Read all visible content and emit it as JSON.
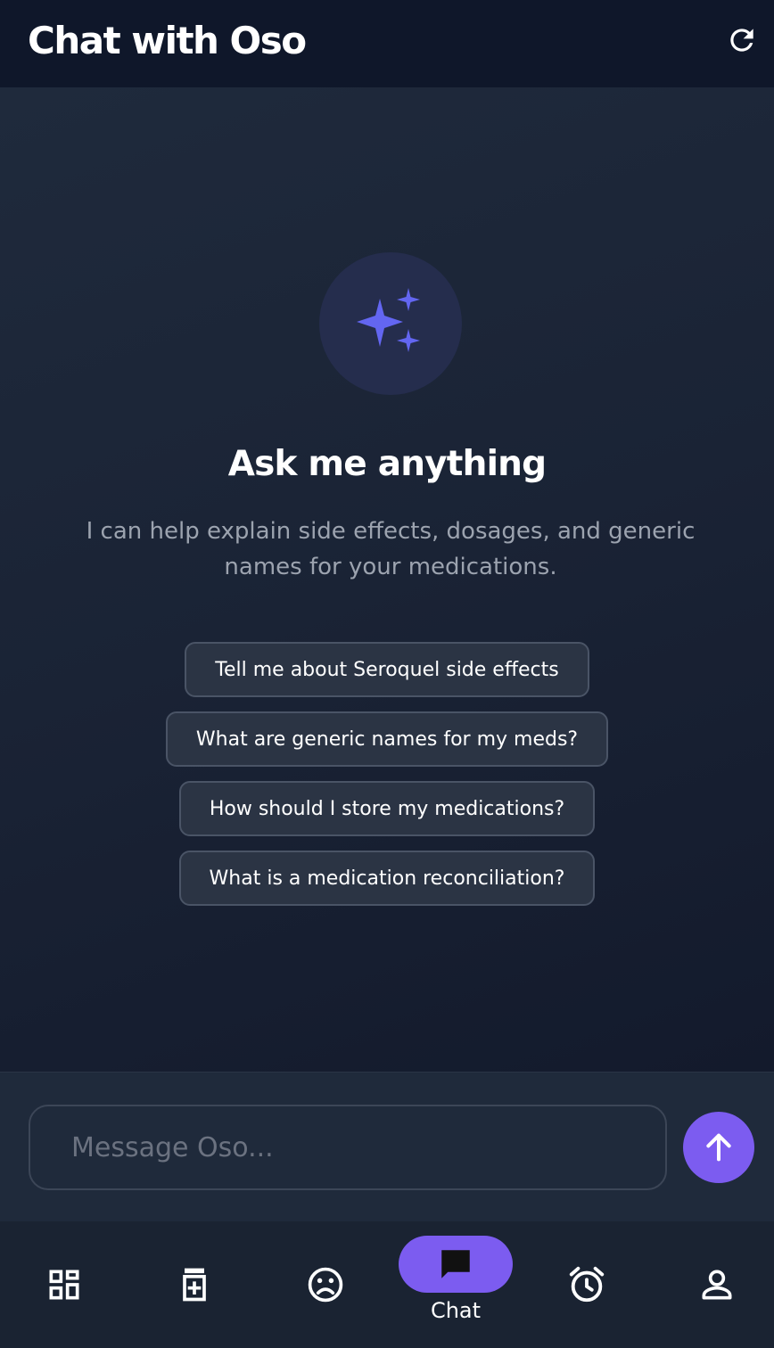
{
  "header": {
    "title": "Chat with Oso",
    "refresh_icon": "refresh-icon"
  },
  "hero": {
    "icon": "sparkles-icon",
    "title": "Ask me anything",
    "subtitle": "I can help explain side effects, dosages, and generic names for your medications."
  },
  "suggestions": [
    "Tell me about Seroquel side effects",
    "What are generic names for my meds?",
    "How should I store my medications?",
    "What is a medication reconciliation?"
  ],
  "composer": {
    "placeholder": "Message Oso...",
    "value": "",
    "send_icon": "arrow-up-icon"
  },
  "nav": {
    "items": [
      {
        "icon": "dashboard-icon"
      },
      {
        "icon": "medication-icon"
      },
      {
        "icon": "mood-icon"
      },
      {
        "icon": "chat-icon",
        "label": "Chat",
        "active": true
      },
      {
        "icon": "alarm-icon"
      },
      {
        "icon": "person-icon"
      }
    ]
  },
  "colors": {
    "accent": "#7c5cf0",
    "header_bg": "#0f172a",
    "background": "#1e293b",
    "sparkle": "#6366f1"
  }
}
